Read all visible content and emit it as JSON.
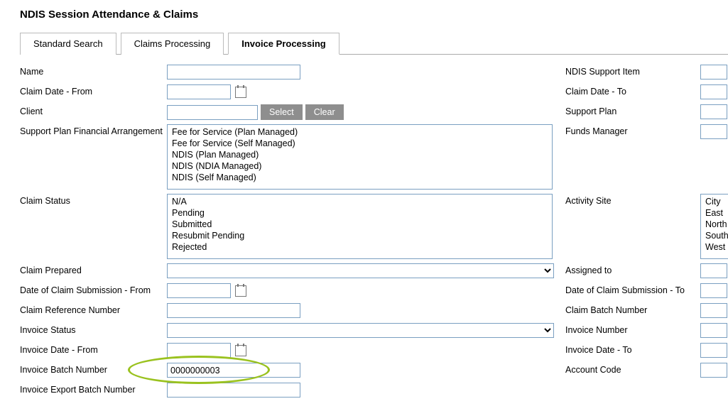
{
  "page_title": "NDIS Session Attendance & Claims",
  "tabs": {
    "standard_search": "Standard Search",
    "claims_processing": "Claims Processing",
    "invoice_processing": "Invoice Processing"
  },
  "labels": {
    "name": "Name",
    "ndis_support_item": "NDIS Support Item",
    "claim_date_from": "Claim Date - From",
    "claim_date_to": "Claim Date - To",
    "client": "Client",
    "support_plan": "Support Plan",
    "spfa": "Support Plan Financial Arrangement",
    "funds_manager": "Funds Manager",
    "claim_status": "Claim Status",
    "activity_site": "Activity Site",
    "claim_prepared": "Claim Prepared",
    "assigned_to": "Assigned to",
    "date_submission_from": "Date of Claim Submission - From",
    "date_submission_to": "Date of Claim Submission - To",
    "claim_ref_number": "Claim Reference Number",
    "claim_batch_number": "Claim Batch Number",
    "invoice_status": "Invoice Status",
    "invoice_number": "Invoice Number",
    "invoice_date_from": "Invoice Date - From",
    "invoice_date_to": "Invoice Date - To",
    "invoice_batch_number": "Invoice Batch Number",
    "account_code": "Account Code",
    "invoice_export_batch_number": "Invoice Export Batch Number"
  },
  "buttons": {
    "select": "Select",
    "clear": "Clear"
  },
  "spfa_options": [
    "Fee for Service (Plan Managed)",
    "Fee for Service (Self Managed)",
    "NDIS (Plan Managed)",
    "NDIS (NDIA Managed)",
    "NDIS (Self Managed)"
  ],
  "claim_status_options": [
    "N/A",
    "Pending",
    "Submitted",
    "Resubmit Pending",
    "Rejected"
  ],
  "activity_site_options": [
    "City",
    "East",
    "North",
    "South",
    "West"
  ],
  "values": {
    "invoice_batch_number": "0000000003"
  }
}
